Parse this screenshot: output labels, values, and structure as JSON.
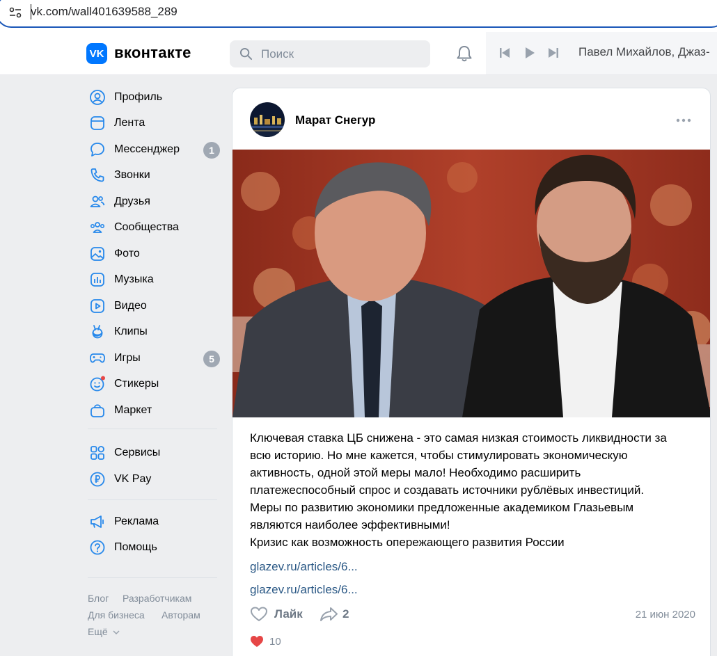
{
  "browser": {
    "url": "vk.com/wall401639588_289"
  },
  "header": {
    "logo_letters": "VK",
    "wordmark": "вконтакте",
    "search_placeholder": "Поиск",
    "now_playing": "Павел Михайлов, Джаз-"
  },
  "nav": {
    "items": [
      {
        "label": "Профиль",
        "icon": "profile-icon"
      },
      {
        "label": "Лента",
        "icon": "feed-icon"
      },
      {
        "label": "Мессенджер",
        "icon": "messenger-icon",
        "badge": "1"
      },
      {
        "label": "Звонки",
        "icon": "phone-icon"
      },
      {
        "label": "Друзья",
        "icon": "friends-icon"
      },
      {
        "label": "Сообщества",
        "icon": "communities-icon"
      },
      {
        "label": "Фото",
        "icon": "photo-icon"
      },
      {
        "label": "Музыка",
        "icon": "music-icon"
      },
      {
        "label": "Видео",
        "icon": "video-icon"
      },
      {
        "label": "Клипы",
        "icon": "clips-icon"
      },
      {
        "label": "Игры",
        "icon": "games-icon",
        "badge": "5"
      },
      {
        "label": "Стикеры",
        "icon": "stickers-icon"
      },
      {
        "label": "Маркет",
        "icon": "market-icon"
      },
      {
        "label": "Сервисы",
        "icon": "services-icon"
      },
      {
        "label": "VK Pay",
        "icon": "vkpay-icon"
      },
      {
        "label": "Реклама",
        "icon": "ads-icon"
      },
      {
        "label": "Помощь",
        "icon": "help-icon"
      }
    ],
    "footer": {
      "blog": "Блог",
      "developers": "Разработчикам",
      "business": "Для бизнеса",
      "authors": "Авторам",
      "more": "Ещё"
    }
  },
  "post": {
    "author": "Марат Снегур",
    "text_lines": [
      "Ключевая ставка ЦБ снижена - это самая низкая стоимость ликвидности за",
      "всю историю. Но мне кажется, чтобы стимулировать экономическую",
      "активность, одной этой меры мало! Необходимо расширить",
      "платежеспособный спрос и создавать источники рублёвых инвестиций.",
      "Меры по развитию экономики предложенные академиком Глазьевым",
      "являются наиболее эффективными!",
      "Кризис как возможность опережающего развития России"
    ],
    "links": [
      "glazev.ru/articles/6...",
      "glazev.ru/articles/6..."
    ],
    "like_label": "Лайк",
    "share_count": "2",
    "date": "21 июн 2020",
    "reaction_count": "10"
  },
  "colors": {
    "accent": "#0077ff",
    "link": "#2a5885",
    "badge": "#a0a8b3",
    "heart": "#e64646"
  }
}
